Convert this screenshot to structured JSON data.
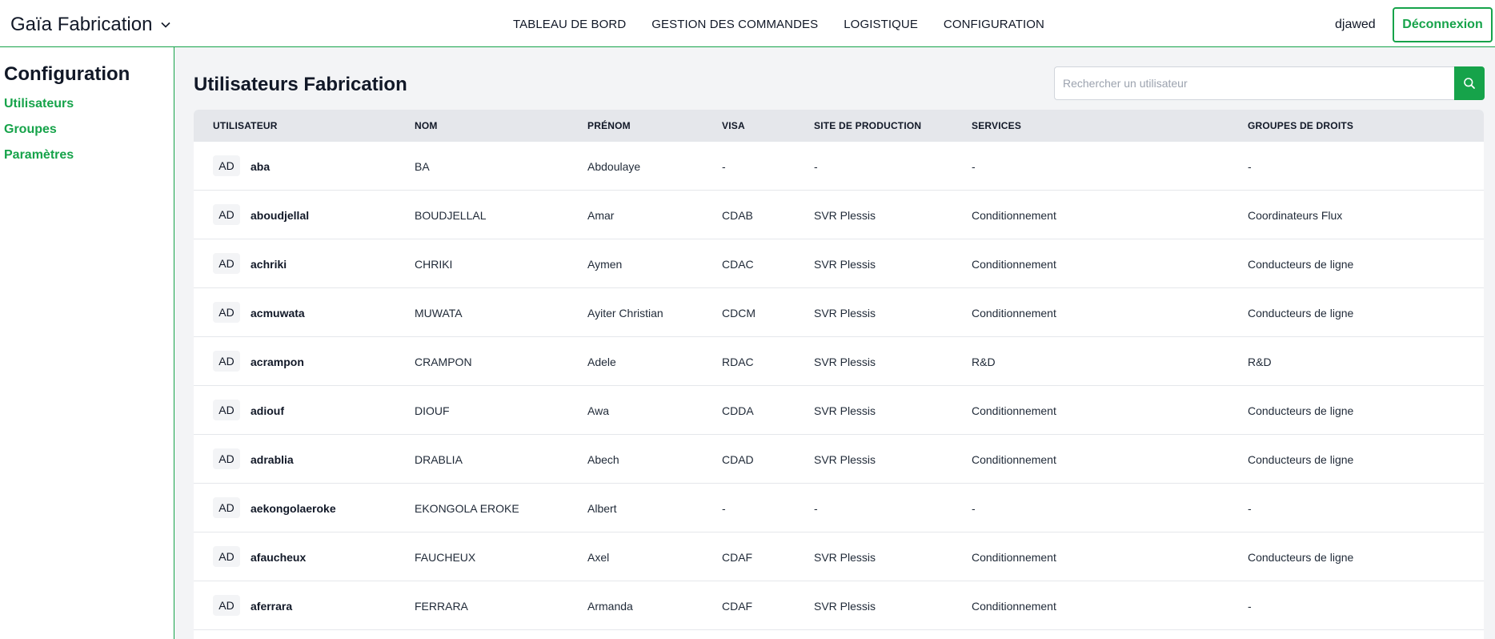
{
  "header": {
    "brand": "Gaïa Fabrication",
    "nav": [
      "TABLEAU DE BORD",
      "GESTION DES COMMANDES",
      "LOGISTIQUE",
      "CONFIGURATION"
    ],
    "user": "djawed",
    "logout_label": "Déconnexion"
  },
  "sidebar": {
    "title": "Configuration",
    "items": [
      "Utilisateurs",
      "Groupes",
      "Paramètres"
    ]
  },
  "main": {
    "title": "Utilisateurs Fabrication",
    "search_placeholder": "Rechercher un utilisateur"
  },
  "table": {
    "columns": [
      "UTILISATEUR",
      "NOM",
      "PRÉNOM",
      "VISA",
      "SITE DE PRODUCTION",
      "SERVICES",
      "GROUPES DE DROITS"
    ],
    "rows": [
      {
        "badge": "AD",
        "login": "aba",
        "nom": "BA",
        "prenom": "Abdoulaye",
        "visa": "-",
        "site": "-",
        "services": "-",
        "groupes": "-"
      },
      {
        "badge": "AD",
        "login": "aboudjellal",
        "nom": "BOUDJELLAL",
        "prenom": "Amar",
        "visa": "CDAB",
        "site": "SVR Plessis",
        "services": "Conditionnement",
        "groupes": "Coordinateurs Flux"
      },
      {
        "badge": "AD",
        "login": "achriki",
        "nom": "CHRIKI",
        "prenom": "Aymen",
        "visa": "CDAC",
        "site": "SVR Plessis",
        "services": "Conditionnement",
        "groupes": "Conducteurs de ligne"
      },
      {
        "badge": "AD",
        "login": "acmuwata",
        "nom": "MUWATA",
        "prenom": "Ayiter Christian",
        "visa": "CDCM",
        "site": "SVR Plessis",
        "services": "Conditionnement",
        "groupes": "Conducteurs de ligne"
      },
      {
        "badge": "AD",
        "login": "acrampon",
        "nom": "CRAMPON",
        "prenom": "Adele",
        "visa": "RDAC",
        "site": "SVR Plessis",
        "services": "R&D",
        "groupes": "R&D"
      },
      {
        "badge": "AD",
        "login": "adiouf",
        "nom": "DIOUF",
        "prenom": "Awa",
        "visa": "CDDA",
        "site": "SVR Plessis",
        "services": "Conditionnement",
        "groupes": "Conducteurs de ligne"
      },
      {
        "badge": "AD",
        "login": "adrablia",
        "nom": "DRABLIA",
        "prenom": "Abech",
        "visa": "CDAD",
        "site": "SVR Plessis",
        "services": "Conditionnement",
        "groupes": "Conducteurs de ligne"
      },
      {
        "badge": "AD",
        "login": "aekongolaeroke",
        "nom": "EKONGOLA EROKE",
        "prenom": "Albert",
        "visa": "-",
        "site": "-",
        "services": "-",
        "groupes": "-"
      },
      {
        "badge": "AD",
        "login": "afaucheux",
        "nom": "FAUCHEUX",
        "prenom": "Axel",
        "visa": "CDAF",
        "site": "SVR Plessis",
        "services": "Conditionnement",
        "groupes": "Conducteurs de ligne"
      },
      {
        "badge": "AD",
        "login": "aferrara",
        "nom": "FERRARA",
        "prenom": "Armanda",
        "visa": "CDAF",
        "site": "SVR Plessis",
        "services": "Conditionnement",
        "groupes": "-"
      }
    ]
  },
  "colors": {
    "accent": "#16a34a",
    "header_bg": "#e5e7eb",
    "page_bg": "#f3f4f6"
  },
  "icons": {
    "brand_toggle": "chevron-down-icon",
    "search": "search-icon"
  }
}
